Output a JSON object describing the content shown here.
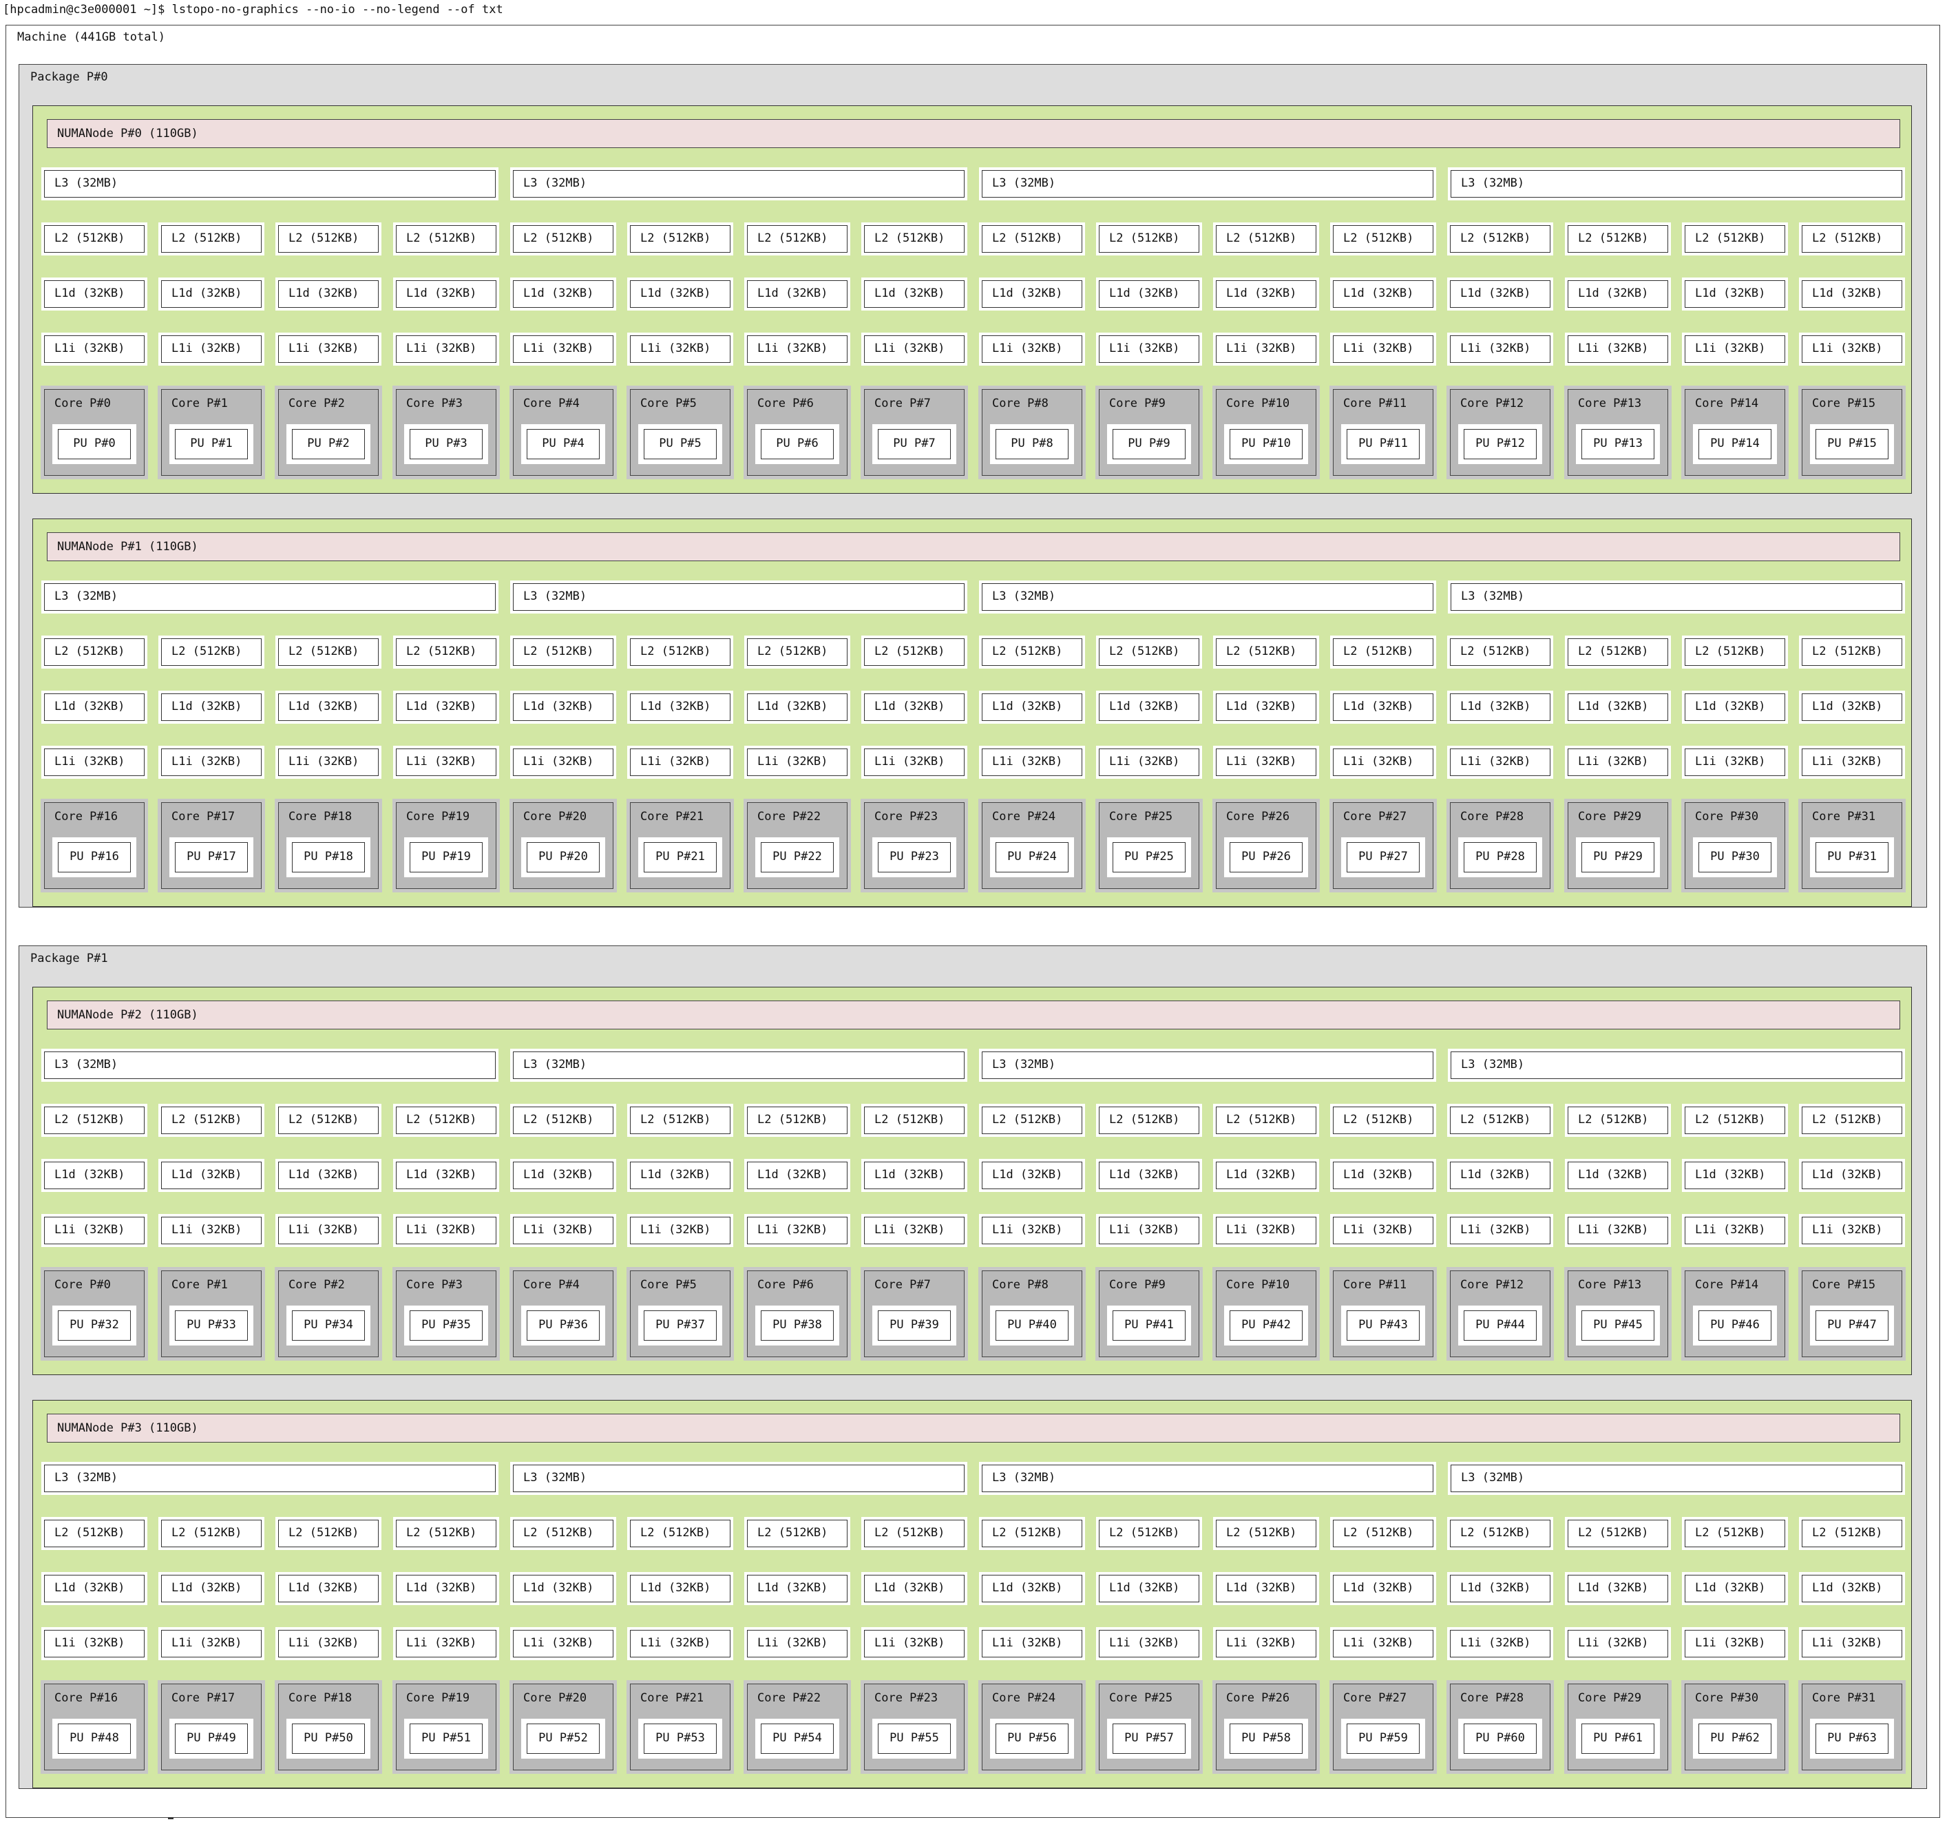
{
  "terminal": {
    "command_line": "[hpcadmin@c3e000001 ~]$ lstopo-no-graphics --no-io --no-legend --of txt"
  },
  "machine": {
    "label": "Machine (441GB total)",
    "packages": [
      {
        "label": "Package P#0",
        "numa_nodes": [
          {
            "label": "NUMANode P#0 (110GB)",
            "l3": [
              "L3 (32MB)",
              "L3 (32MB)",
              "L3 (32MB)",
              "L3 (32MB)"
            ],
            "cores": [
              {
                "core": "Core P#0",
                "pu": "PU P#0",
                "l2": "L2 (512KB)",
                "l1d": "L1d (32KB)",
                "l1i": "L1i (32KB)"
              },
              {
                "core": "Core P#1",
                "pu": "PU P#1",
                "l2": "L2 (512KB)",
                "l1d": "L1d (32KB)",
                "l1i": "L1i (32KB)"
              },
              {
                "core": "Core P#2",
                "pu": "PU P#2",
                "l2": "L2 (512KB)",
                "l1d": "L1d (32KB)",
                "l1i": "L1i (32KB)"
              },
              {
                "core": "Core P#3",
                "pu": "PU P#3",
                "l2": "L2 (512KB)",
                "l1d": "L1d (32KB)",
                "l1i": "L1i (32KB)"
              },
              {
                "core": "Core P#4",
                "pu": "PU P#4",
                "l2": "L2 (512KB)",
                "l1d": "L1d (32KB)",
                "l1i": "L1i (32KB)"
              },
              {
                "core": "Core P#5",
                "pu": "PU P#5",
                "l2": "L2 (512KB)",
                "l1d": "L1d (32KB)",
                "l1i": "L1i (32KB)"
              },
              {
                "core": "Core P#6",
                "pu": "PU P#6",
                "l2": "L2 (512KB)",
                "l1d": "L1d (32KB)",
                "l1i": "L1i (32KB)"
              },
              {
                "core": "Core P#7",
                "pu": "PU P#7",
                "l2": "L2 (512KB)",
                "l1d": "L1d (32KB)",
                "l1i": "L1i (32KB)"
              },
              {
                "core": "Core P#8",
                "pu": "PU P#8",
                "l2": "L2 (512KB)",
                "l1d": "L1d (32KB)",
                "l1i": "L1i (32KB)"
              },
              {
                "core": "Core P#9",
                "pu": "PU P#9",
                "l2": "L2 (512KB)",
                "l1d": "L1d (32KB)",
                "l1i": "L1i (32KB)"
              },
              {
                "core": "Core P#10",
                "pu": "PU P#10",
                "l2": "L2 (512KB)",
                "l1d": "L1d (32KB)",
                "l1i": "L1i (32KB)"
              },
              {
                "core": "Core P#11",
                "pu": "PU P#11",
                "l2": "L2 (512KB)",
                "l1d": "L1d (32KB)",
                "l1i": "L1i (32KB)"
              },
              {
                "core": "Core P#12",
                "pu": "PU P#12",
                "l2": "L2 (512KB)",
                "l1d": "L1d (32KB)",
                "l1i": "L1i (32KB)"
              },
              {
                "core": "Core P#13",
                "pu": "PU P#13",
                "l2": "L2 (512KB)",
                "l1d": "L1d (32KB)",
                "l1i": "L1i (32KB)"
              },
              {
                "core": "Core P#14",
                "pu": "PU P#14",
                "l2": "L2 (512KB)",
                "l1d": "L1d (32KB)",
                "l1i": "L1i (32KB)"
              },
              {
                "core": "Core P#15",
                "pu": "PU P#15",
                "l2": "L2 (512KB)",
                "l1d": "L1d (32KB)",
                "l1i": "L1i (32KB)"
              }
            ]
          },
          {
            "label": "NUMANode P#1 (110GB)",
            "l3": [
              "L3 (32MB)",
              "L3 (32MB)",
              "L3 (32MB)",
              "L3 (32MB)"
            ],
            "cores": [
              {
                "core": "Core P#16",
                "pu": "PU P#16",
                "l2": "L2 (512KB)",
                "l1d": "L1d (32KB)",
                "l1i": "L1i (32KB)"
              },
              {
                "core": "Core P#17",
                "pu": "PU P#17",
                "l2": "L2 (512KB)",
                "l1d": "L1d (32KB)",
                "l1i": "L1i (32KB)"
              },
              {
                "core": "Core P#18",
                "pu": "PU P#18",
                "l2": "L2 (512KB)",
                "l1d": "L1d (32KB)",
                "l1i": "L1i (32KB)"
              },
              {
                "core": "Core P#19",
                "pu": "PU P#19",
                "l2": "L2 (512KB)",
                "l1d": "L1d (32KB)",
                "l1i": "L1i (32KB)"
              },
              {
                "core": "Core P#20",
                "pu": "PU P#20",
                "l2": "L2 (512KB)",
                "l1d": "L1d (32KB)",
                "l1i": "L1i (32KB)"
              },
              {
                "core": "Core P#21",
                "pu": "PU P#21",
                "l2": "L2 (512KB)",
                "l1d": "L1d (32KB)",
                "l1i": "L1i (32KB)"
              },
              {
                "core": "Core P#22",
                "pu": "PU P#22",
                "l2": "L2 (512KB)",
                "l1d": "L1d (32KB)",
                "l1i": "L1i (32KB)"
              },
              {
                "core": "Core P#23",
                "pu": "PU P#23",
                "l2": "L2 (512KB)",
                "l1d": "L1d (32KB)",
                "l1i": "L1i (32KB)"
              },
              {
                "core": "Core P#24",
                "pu": "PU P#24",
                "l2": "L2 (512KB)",
                "l1d": "L1d (32KB)",
                "l1i": "L1i (32KB)"
              },
              {
                "core": "Core P#25",
                "pu": "PU P#25",
                "l2": "L2 (512KB)",
                "l1d": "L1d (32KB)",
                "l1i": "L1i (32KB)"
              },
              {
                "core": "Core P#26",
                "pu": "PU P#26",
                "l2": "L2 (512KB)",
                "l1d": "L1d (32KB)",
                "l1i": "L1i (32KB)"
              },
              {
                "core": "Core P#27",
                "pu": "PU P#27",
                "l2": "L2 (512KB)",
                "l1d": "L1d (32KB)",
                "l1i": "L1i (32KB)"
              },
              {
                "core": "Core P#28",
                "pu": "PU P#28",
                "l2": "L2 (512KB)",
                "l1d": "L1d (32KB)",
                "l1i": "L1i (32KB)"
              },
              {
                "core": "Core P#29",
                "pu": "PU P#29",
                "l2": "L2 (512KB)",
                "l1d": "L1d (32KB)",
                "l1i": "L1i (32KB)"
              },
              {
                "core": "Core P#30",
                "pu": "PU P#30",
                "l2": "L2 (512KB)",
                "l1d": "L1d (32KB)",
                "l1i": "L1i (32KB)"
              },
              {
                "core": "Core P#31",
                "pu": "PU P#31",
                "l2": "L2 (512KB)",
                "l1d": "L1d (32KB)",
                "l1i": "L1i (32KB)"
              }
            ]
          }
        ]
      },
      {
        "label": "Package P#1",
        "numa_nodes": [
          {
            "label": "NUMANode P#2 (110GB)",
            "l3": [
              "L3 (32MB)",
              "L3 (32MB)",
              "L3 (32MB)",
              "L3 (32MB)"
            ],
            "cores": [
              {
                "core": "Core P#0",
                "pu": "PU P#32",
                "l2": "L2 (512KB)",
                "l1d": "L1d (32KB)",
                "l1i": "L1i (32KB)"
              },
              {
                "core": "Core P#1",
                "pu": "PU P#33",
                "l2": "L2 (512KB)",
                "l1d": "L1d (32KB)",
                "l1i": "L1i (32KB)"
              },
              {
                "core": "Core P#2",
                "pu": "PU P#34",
                "l2": "L2 (512KB)",
                "l1d": "L1d (32KB)",
                "l1i": "L1i (32KB)"
              },
              {
                "core": "Core P#3",
                "pu": "PU P#35",
                "l2": "L2 (512KB)",
                "l1d": "L1d (32KB)",
                "l1i": "L1i (32KB)"
              },
              {
                "core": "Core P#4",
                "pu": "PU P#36",
                "l2": "L2 (512KB)",
                "l1d": "L1d (32KB)",
                "l1i": "L1i (32KB)"
              },
              {
                "core": "Core P#5",
                "pu": "PU P#37",
                "l2": "L2 (512KB)",
                "l1d": "L1d (32KB)",
                "l1i": "L1i (32KB)"
              },
              {
                "core": "Core P#6",
                "pu": "PU P#38",
                "l2": "L2 (512KB)",
                "l1d": "L1d (32KB)",
                "l1i": "L1i (32KB)"
              },
              {
                "core": "Core P#7",
                "pu": "PU P#39",
                "l2": "L2 (512KB)",
                "l1d": "L1d (32KB)",
                "l1i": "L1i (32KB)"
              },
              {
                "core": "Core P#8",
                "pu": "PU P#40",
                "l2": "L2 (512KB)",
                "l1d": "L1d (32KB)",
                "l1i": "L1i (32KB)"
              },
              {
                "core": "Core P#9",
                "pu": "PU P#41",
                "l2": "L2 (512KB)",
                "l1d": "L1d (32KB)",
                "l1i": "L1i (32KB)"
              },
              {
                "core": "Core P#10",
                "pu": "PU P#42",
                "l2": "L2 (512KB)",
                "l1d": "L1d (32KB)",
                "l1i": "L1i (32KB)"
              },
              {
                "core": "Core P#11",
                "pu": "PU P#43",
                "l2": "L2 (512KB)",
                "l1d": "L1d (32KB)",
                "l1i": "L1i (32KB)"
              },
              {
                "core": "Core P#12",
                "pu": "PU P#44",
                "l2": "L2 (512KB)",
                "l1d": "L1d (32KB)",
                "l1i": "L1i (32KB)"
              },
              {
                "core": "Core P#13",
                "pu": "PU P#45",
                "l2": "L2 (512KB)",
                "l1d": "L1d (32KB)",
                "l1i": "L1i (32KB)"
              },
              {
                "core": "Core P#14",
                "pu": "PU P#46",
                "l2": "L2 (512KB)",
                "l1d": "L1d (32KB)",
                "l1i": "L1i (32KB)"
              },
              {
                "core": "Core P#15",
                "pu": "PU P#47",
                "l2": "L2 (512KB)",
                "l1d": "L1d (32KB)",
                "l1i": "L1i (32KB)"
              }
            ]
          },
          {
            "label": "NUMANode P#3 (110GB)",
            "l3": [
              "L3 (32MB)",
              "L3 (32MB)",
              "L3 (32MB)",
              "L3 (32MB)"
            ],
            "cores": [
              {
                "core": "Core P#16",
                "pu": "PU P#48",
                "l2": "L2 (512KB)",
                "l1d": "L1d (32KB)",
                "l1i": "L1i (32KB)"
              },
              {
                "core": "Core P#17",
                "pu": "PU P#49",
                "l2": "L2 (512KB)",
                "l1d": "L1d (32KB)",
                "l1i": "L1i (32KB)"
              },
              {
                "core": "Core P#18",
                "pu": "PU P#50",
                "l2": "L2 (512KB)",
                "l1d": "L1d (32KB)",
                "l1i": "L1i (32KB)"
              },
              {
                "core": "Core P#19",
                "pu": "PU P#51",
                "l2": "L2 (512KB)",
                "l1d": "L1d (32KB)",
                "l1i": "L1i (32KB)"
              },
              {
                "core": "Core P#20",
                "pu": "PU P#52",
                "l2": "L2 (512KB)",
                "l1d": "L1d (32KB)",
                "l1i": "L1i (32KB)"
              },
              {
                "core": "Core P#21",
                "pu": "PU P#53",
                "l2": "L2 (512KB)",
                "l1d": "L1d (32KB)",
                "l1i": "L1i (32KB)"
              },
              {
                "core": "Core P#22",
                "pu": "PU P#54",
                "l2": "L2 (512KB)",
                "l1d": "L1d (32KB)",
                "l1i": "L1i (32KB)"
              },
              {
                "core": "Core P#23",
                "pu": "PU P#55",
                "l2": "L2 (512KB)",
                "l1d": "L1d (32KB)",
                "l1i": "L1i (32KB)"
              },
              {
                "core": "Core P#24",
                "pu": "PU P#56",
                "l2": "L2 (512KB)",
                "l1d": "L1d (32KB)",
                "l1i": "L1i (32KB)"
              },
              {
                "core": "Core P#25",
                "pu": "PU P#57",
                "l2": "L2 (512KB)",
                "l1d": "L1d (32KB)",
                "l1i": "L1i (32KB)"
              },
              {
                "core": "Core P#26",
                "pu": "PU P#58",
                "l2": "L2 (512KB)",
                "l1d": "L1d (32KB)",
                "l1i": "L1i (32KB)"
              },
              {
                "core": "Core P#27",
                "pu": "PU P#59",
                "l2": "L2 (512KB)",
                "l1d": "L1d (32KB)",
                "l1i": "L1i (32KB)"
              },
              {
                "core": "Core P#28",
                "pu": "PU P#60",
                "l2": "L2 (512KB)",
                "l1d": "L1d (32KB)",
                "l1i": "L1i (32KB)"
              },
              {
                "core": "Core P#29",
                "pu": "PU P#61",
                "l2": "L2 (512KB)",
                "l1d": "L1d (32KB)",
                "l1i": "L1i (32KB)"
              },
              {
                "core": "Core P#30",
                "pu": "PU P#62",
                "l2": "L2 (512KB)",
                "l1d": "L1d (32KB)",
                "l1i": "L1i (32KB)"
              },
              {
                "core": "Core P#31",
                "pu": "PU P#63",
                "l2": "L2 (512KB)",
                "l1d": "L1d (32KB)",
                "l1i": "L1i (32KB)"
              }
            ]
          }
        ]
      }
    ]
  },
  "colors": {
    "package_bg": "#dddddd",
    "numa_group_bg": "#d2e7a4",
    "numa_node_bg": "#efdede",
    "cache_bg": "#ffffff",
    "core_bg": "#b9b9b9",
    "pu_bg": "#ffffff"
  }
}
